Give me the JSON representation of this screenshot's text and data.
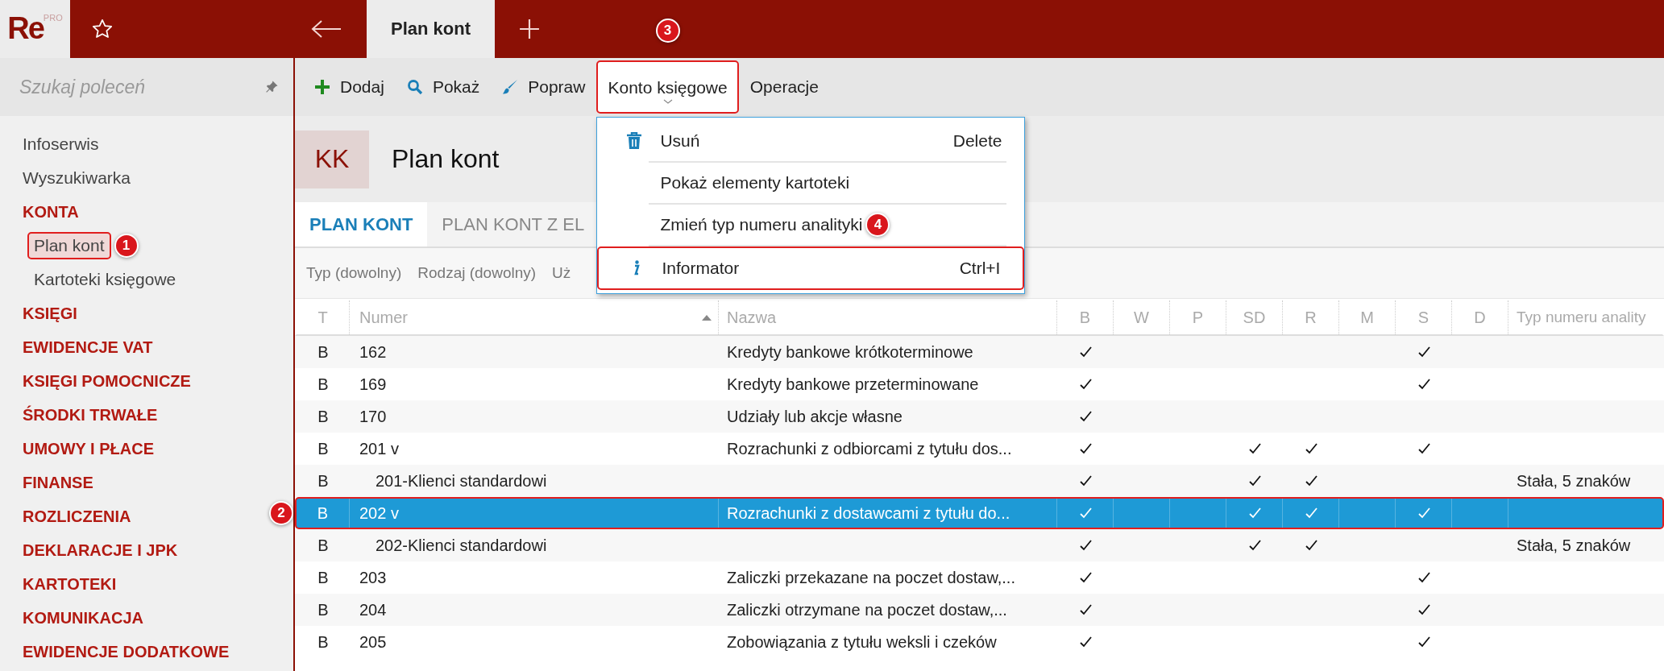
{
  "app": {
    "logo": "Re",
    "logo_badge": "PRO"
  },
  "tabs": [
    {
      "label": "Plan kont",
      "selected": true
    }
  ],
  "sidebar": {
    "search": {
      "placeholder": "Szukaj poleceń"
    },
    "items": [
      {
        "label": "Infoserwis",
        "kind": "link",
        "selected": false
      },
      {
        "label": "Wyszukiwarka",
        "kind": "link",
        "selected": false
      },
      {
        "label": "KONTA",
        "kind": "section",
        "selected": false,
        "children": [
          {
            "label": "Plan kont",
            "selected": true,
            "callout": "1"
          },
          {
            "label": "Kartoteki księgowe",
            "selected": false
          }
        ]
      },
      {
        "label": "KSIĘGI",
        "kind": "section",
        "selected": false
      },
      {
        "label": "EWIDENCJE VAT",
        "kind": "section",
        "selected": false
      },
      {
        "label": "KSIĘGI POMOCNICZE",
        "kind": "section",
        "selected": false
      },
      {
        "label": "ŚRODKI TRWAŁE",
        "kind": "section",
        "selected": false
      },
      {
        "label": "UMOWY I PŁACE",
        "kind": "section",
        "selected": false
      },
      {
        "label": "FINANSE",
        "kind": "section",
        "selected": false
      },
      {
        "label": "ROZLICZENIA",
        "kind": "section",
        "selected": false
      },
      {
        "label": "DEKLARACJE I JPK",
        "kind": "section",
        "selected": false
      },
      {
        "label": "KARTOTEKI",
        "kind": "section",
        "selected": false
      },
      {
        "label": "KOMUNIKACJA",
        "kind": "section",
        "selected": false
      },
      {
        "label": "EWIDENCJE DODATKOWE",
        "kind": "section",
        "selected": false
      }
    ]
  },
  "toolbar": [
    {
      "label": "Dodaj",
      "expanded": false
    },
    {
      "label": "Pokaż",
      "expanded": false
    },
    {
      "label": "Popraw",
      "expanded": false
    },
    {
      "label": "Konto księgowe",
      "expanded": true,
      "callout": "3",
      "menu": [
        {
          "label": "Usuń",
          "shortcut": "Delete",
          "highlighted": false
        },
        {
          "label": "Pokaż elementy kartoteki",
          "highlighted": false
        },
        {
          "label": "Zmień typ numeru analityki",
          "highlighted": false,
          "callout": "4"
        },
        {
          "label": "Informator",
          "shortcut": "Ctrl+I",
          "highlighted": true
        }
      ]
    },
    {
      "label": "Operacje",
      "expanded": false
    }
  ],
  "header": {
    "badge": "KK",
    "title": "Plan kont"
  },
  "view_tabs": [
    {
      "label": "PLAN KONT",
      "selected": true
    },
    {
      "label": "PLAN KONT Z EL",
      "selected": false
    }
  ],
  "filters": [
    "Typ (dowolny)",
    "Rodzaj (dowolny)",
    "Uż"
  ],
  "table": {
    "columns": [
      {
        "label": "T",
        "sorted": false
      },
      {
        "label": "Numer",
        "sorted": true
      },
      {
        "label": "Nazwa",
        "sorted": false
      },
      {
        "label": "B",
        "sorted": false
      },
      {
        "label": "W",
        "sorted": false
      },
      {
        "label": "P",
        "sorted": false
      },
      {
        "label": "SD",
        "sorted": false
      },
      {
        "label": "R",
        "sorted": false
      },
      {
        "label": "M",
        "sorted": false
      },
      {
        "label": "S",
        "sorted": false
      },
      {
        "label": "D",
        "sorted": false
      },
      {
        "label": "Typ numeru anality",
        "sorted": false
      }
    ],
    "rows": [
      {
        "type": "B",
        "number": "162",
        "name": "Kredyty bankowe krótkoterminowe",
        "checks": [
          true,
          false,
          false,
          false,
          false,
          false,
          true,
          false
        ],
        "selected": false
      },
      {
        "type": "B",
        "number": "169",
        "name": "Kredyty bankowe przeterminowane",
        "checks": [
          true,
          false,
          false,
          false,
          false,
          false,
          true,
          false
        ],
        "selected": false
      },
      {
        "type": "B",
        "number": "170",
        "name": "Udziały lub akcje własne",
        "checks": [
          true,
          false,
          false,
          false,
          false,
          false,
          false,
          false
        ],
        "selected": false
      },
      {
        "type": "B",
        "number": "201 v",
        "name": "Rozrachunki z odbiorcami z tytułu dos...",
        "checks": [
          true,
          false,
          false,
          true,
          true,
          false,
          true,
          false
        ],
        "selected": false,
        "children": [
          {
            "type": "B",
            "number": "201-Klienci standardowi",
            "checks": [
              true,
              false,
              false,
              true,
              true,
              false,
              false,
              false
            ],
            "analytics": "Stała, 5 znaków",
            "selected": false
          }
        ]
      },
      {
        "type": "B",
        "number": "202 v",
        "name": "Rozrachunki z dostawcami z tytułu do...",
        "checks": [
          true,
          false,
          false,
          true,
          true,
          false,
          true,
          false
        ],
        "selected": true,
        "callout": "2",
        "children": [
          {
            "type": "B",
            "number": "202-Klienci standardowi",
            "checks": [
              true,
              false,
              false,
              true,
              true,
              false,
              false,
              false
            ],
            "analytics": "Stała, 5 znaków",
            "selected": false
          }
        ]
      },
      {
        "type": "B",
        "number": "203",
        "name": "Zaliczki przekazane na poczet dostaw,...",
        "checks": [
          true,
          false,
          false,
          false,
          false,
          false,
          true,
          false
        ],
        "selected": false
      },
      {
        "type": "B",
        "number": "204",
        "name": "Zaliczki otrzymane na poczet dostaw,...",
        "checks": [
          true,
          false,
          false,
          false,
          false,
          false,
          true,
          false
        ],
        "selected": false
      },
      {
        "type": "B",
        "number": "205",
        "name": "Zobowiązania z tytułu weksli i czeków",
        "checks": [
          true,
          false,
          false,
          false,
          false,
          false,
          true,
          false
        ],
        "selected": false
      }
    ]
  }
}
